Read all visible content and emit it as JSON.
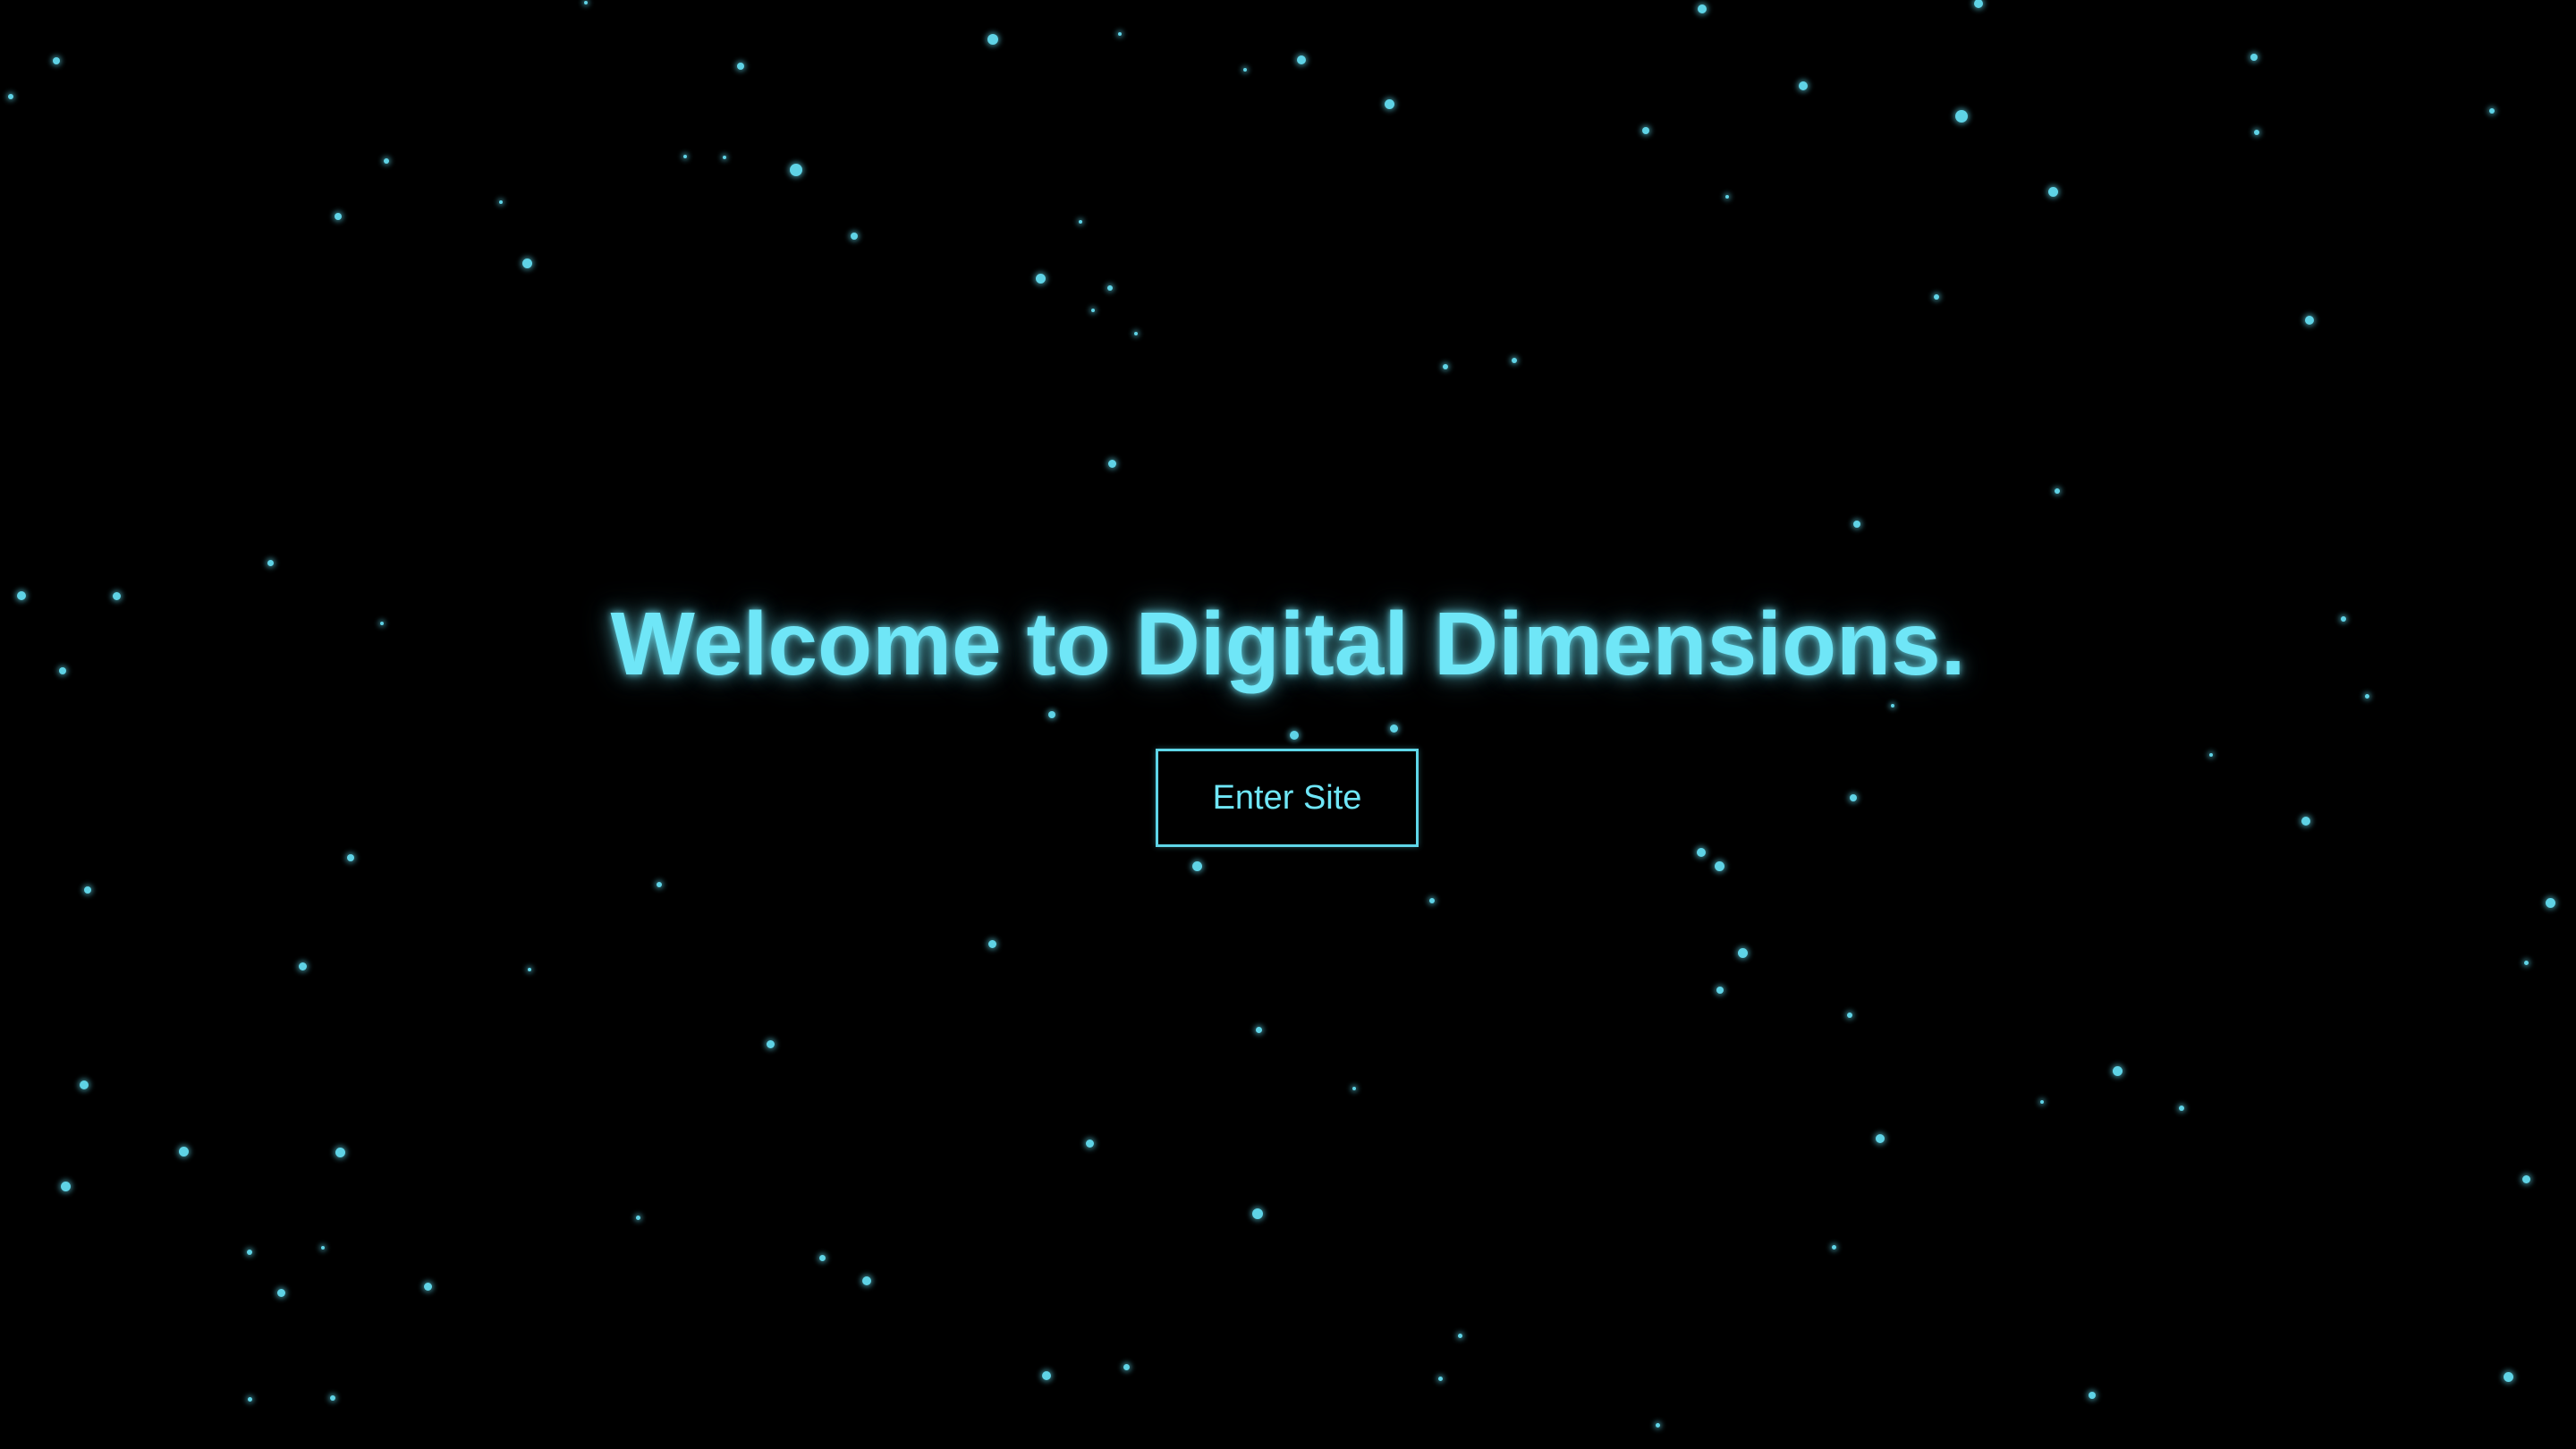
{
  "page": {
    "headline": "Welcome to Digital Dimensions.",
    "enter_button_label": "Enter Site"
  },
  "theme": {
    "background": "#000000",
    "accent": "#6fe6f7",
    "star_color": "#5fd3e6"
  }
}
